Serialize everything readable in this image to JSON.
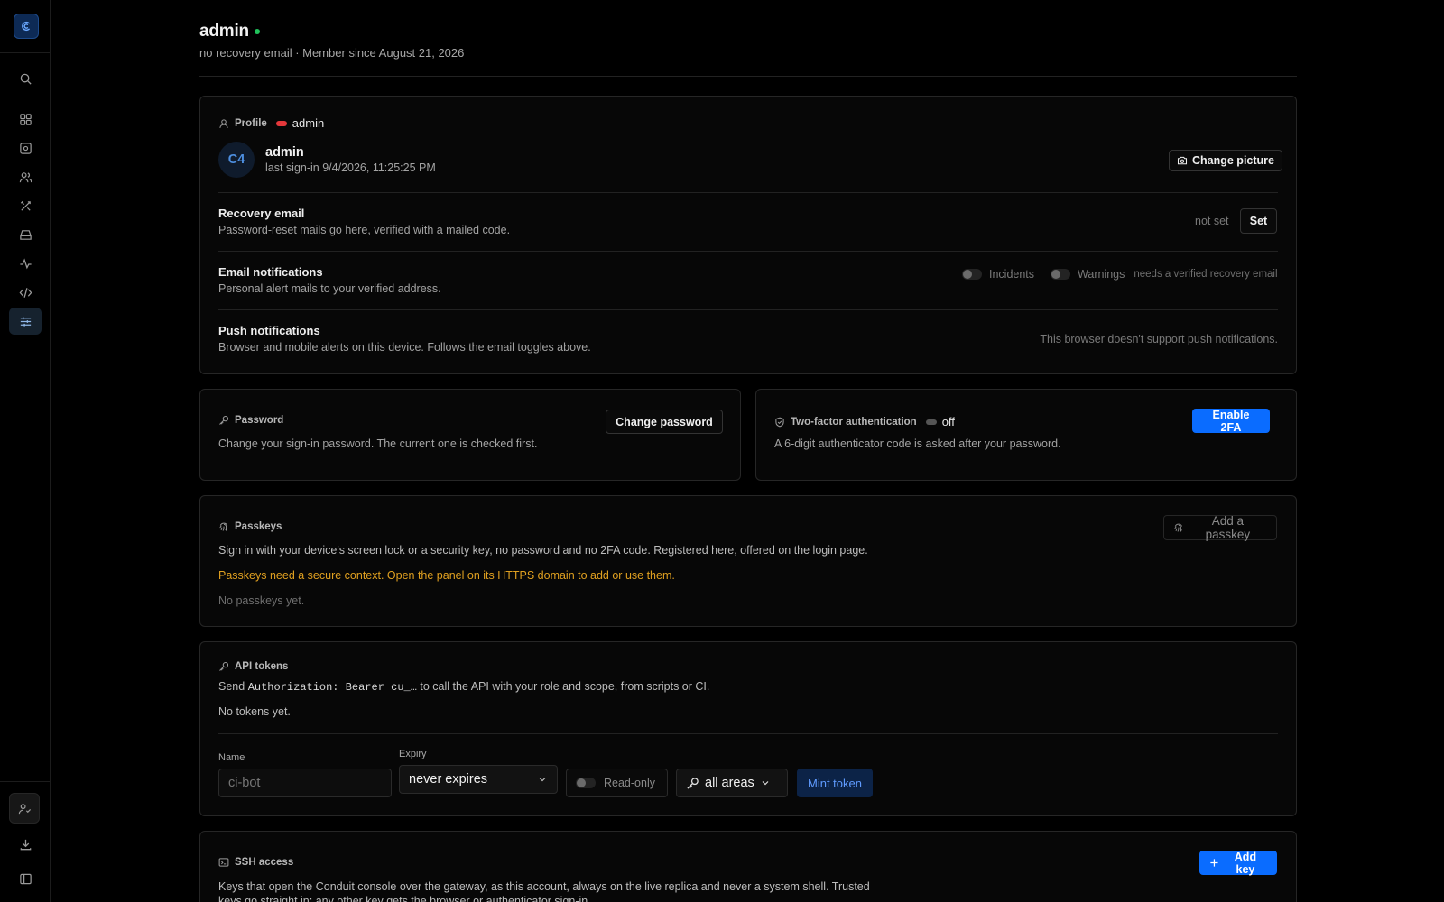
{
  "header": {
    "title": "admin",
    "subtitle": "no recovery email · Member since August 21, 2026"
  },
  "profile": {
    "section_label": "Profile",
    "role": "admin",
    "avatar_initials": "C4",
    "username": "admin",
    "last_signin": "last sign-in 9/4/2026, 11:25:25 PM",
    "change_picture": "Change picture",
    "recovery": {
      "title": "Recovery email",
      "desc": "Password-reset mails go here, verified with a mailed code.",
      "status": "not set",
      "button": "Set"
    },
    "email_notifications": {
      "title": "Email notifications",
      "desc": "Personal alert mails to your verified address.",
      "incidents": "Incidents",
      "warnings": "Warnings",
      "hint": "needs a verified recovery email"
    },
    "push": {
      "title": "Push notifications",
      "desc": "Browser and mobile alerts on this device. Follows the email toggles above.",
      "status": "This browser doesn't support push notifications."
    }
  },
  "password": {
    "label": "Password",
    "desc": "Change your sign-in password. The current one is checked first.",
    "button": "Change password"
  },
  "twofa": {
    "label": "Two-factor authentication",
    "state": "off",
    "desc": "A 6-digit authenticator code is asked after your password.",
    "button": "Enable 2FA"
  },
  "passkeys": {
    "label": "Passkeys",
    "desc": "Sign in with your device's screen lock or a security key, no password and no 2FA code. Registered here, offered on the login page.",
    "warning": "Passkeys need a secure context. Open the panel on its HTTPS domain to add or use them.",
    "empty": "No passkeys yet.",
    "button": "Add a passkey"
  },
  "api_tokens": {
    "label": "API tokens",
    "desc_pre": "Send",
    "desc_code": "Authorization: Bearer cu_…",
    "desc_post": "to call the API with your role and scope, from scripts or CI.",
    "empty": "No tokens yet.",
    "name_label": "Name",
    "name_placeholder": "ci-bot",
    "expiry_label": "Expiry",
    "expiry_value": "never expires",
    "readonly_label": "Read-only",
    "scope_value": "all areas",
    "mint_button": "Mint token"
  },
  "ssh": {
    "label": "SSH access",
    "desc": "Keys that open the Conduit console over the gateway, as this account, always on the live replica and never a system shell. Trusted keys go straight in; any other key gets the browser or authenticator sign-in.",
    "button": "Add key"
  },
  "colors": {
    "accent": "#0a6cff",
    "online": "#21c35c",
    "role_badge": "#e5383b",
    "warning": "#e0a020"
  }
}
